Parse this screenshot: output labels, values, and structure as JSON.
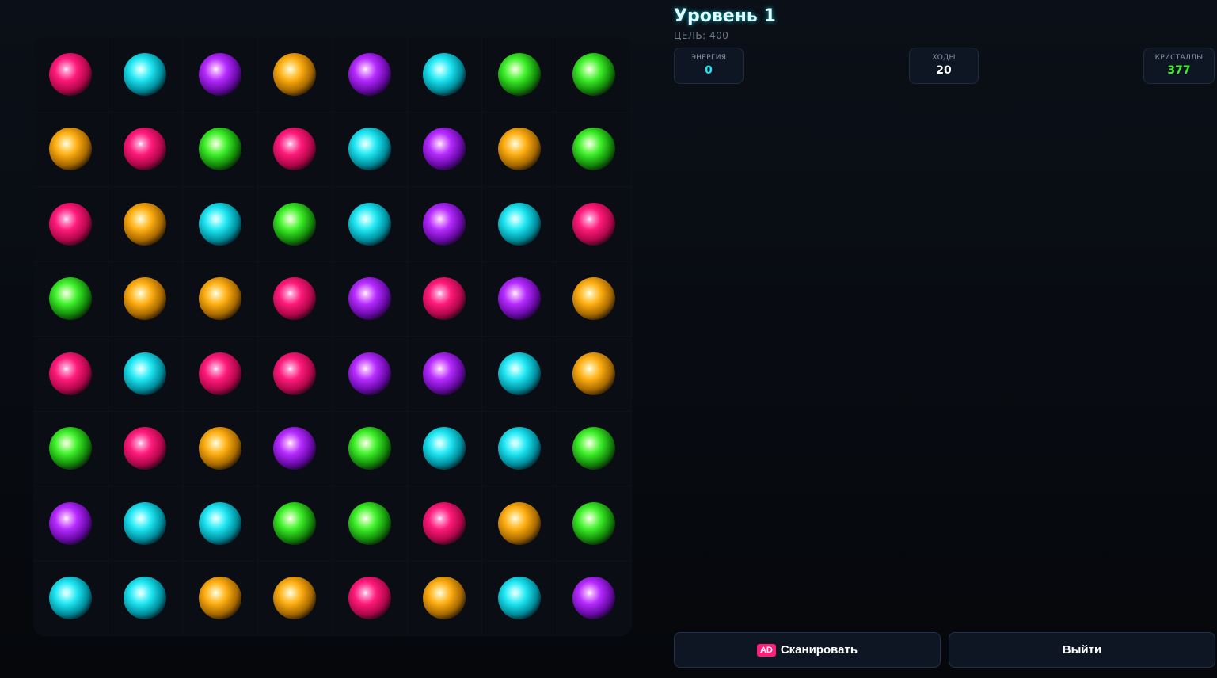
{
  "level": {
    "title": "Уровень 1",
    "goal": "ЦЕЛЬ: 400"
  },
  "stats": {
    "energy": {
      "label": "ЭНЕРГИЯ",
      "value": "0",
      "color": "#1fe6f2"
    },
    "moves": {
      "label": "ХОДЫ",
      "value": "20",
      "color": "#ffffff"
    },
    "crystals": {
      "label": "КРИСТАЛЛЫ",
      "value": "377",
      "color": "#3ef02a"
    }
  },
  "buttons": {
    "ad_badge": "AD",
    "scan": "Сканировать",
    "exit": "Выйти"
  },
  "orb_colors": {
    "pink": "#ff1a7a",
    "cyan": "#1fe6f2",
    "purple": "#b52bff",
    "orange": "#ffae12",
    "green": "#3ef02a"
  },
  "board": [
    [
      "pink",
      "cyan",
      "purple",
      "orange",
      "purple",
      "cyan",
      "green",
      "green"
    ],
    [
      "orange",
      "pink",
      "green",
      "pink",
      "cyan",
      "purple",
      "orange",
      "green"
    ],
    [
      "pink",
      "orange",
      "cyan",
      "green",
      "cyan",
      "purple",
      "cyan",
      "pink"
    ],
    [
      "green",
      "orange",
      "orange",
      "pink",
      "purple",
      "pink",
      "purple",
      "orange"
    ],
    [
      "pink",
      "cyan",
      "pink",
      "pink",
      "purple",
      "purple",
      "cyan",
      "orange"
    ],
    [
      "green",
      "pink",
      "orange",
      "purple",
      "green",
      "cyan",
      "cyan",
      "green"
    ],
    [
      "purple",
      "cyan",
      "cyan",
      "green",
      "green",
      "pink",
      "orange",
      "green"
    ],
    [
      "cyan",
      "cyan",
      "orange",
      "orange",
      "pink",
      "orange",
      "cyan",
      "purple"
    ]
  ]
}
